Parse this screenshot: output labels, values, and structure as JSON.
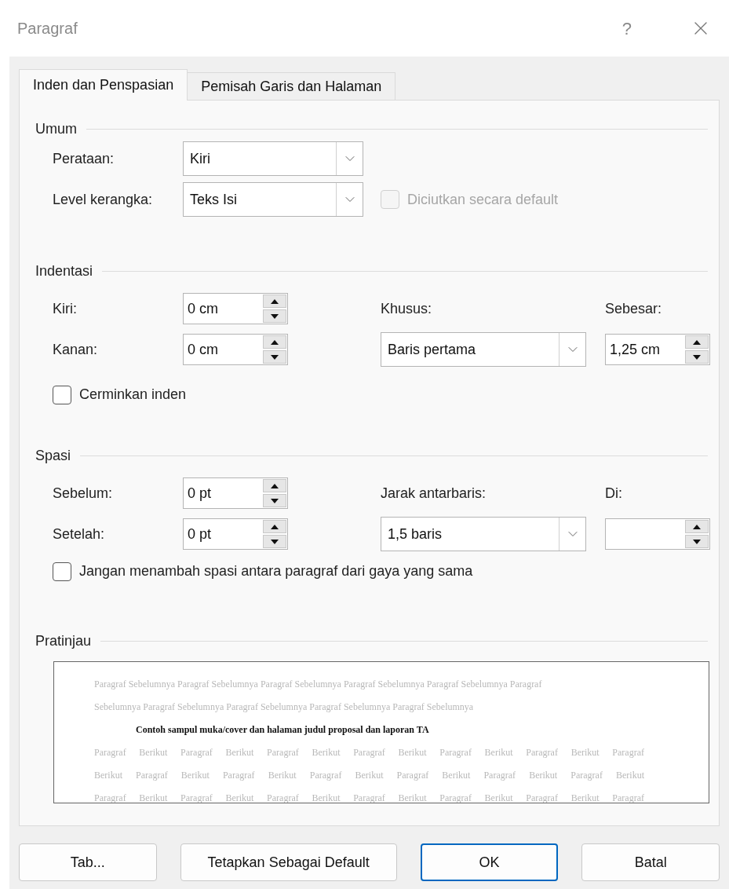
{
  "window": {
    "title": "Paragraf",
    "help": "?"
  },
  "tabs": [
    {
      "label": "Inden dan Penspasian",
      "selected": true
    },
    {
      "label": "Pemisah Garis dan Halaman",
      "selected": false
    }
  ],
  "general": {
    "title": "Umum",
    "alignment": {
      "label": "Perataan:",
      "value": "Kiri"
    },
    "outline_level": {
      "label": "Level kerangka:",
      "value": "Teks Isi"
    },
    "collapsed": {
      "label": "Diciutkan secara default",
      "checked": false,
      "disabled": true
    }
  },
  "indentation": {
    "title": "Indentasi",
    "left": {
      "label": "Kiri:",
      "value": "0 cm"
    },
    "right": {
      "label": "Kanan:",
      "value": "0 cm"
    },
    "special": {
      "label": "Khusus:",
      "value": "Baris pertama"
    },
    "by": {
      "label": "Sebesar:",
      "value": "1,25 cm"
    },
    "mirror": {
      "label": "Cerminkan inden",
      "checked": false,
      "disabled": false
    }
  },
  "spacing": {
    "title": "Spasi",
    "before": {
      "label": "Sebelum:",
      "value": "0 pt"
    },
    "after": {
      "label": "Setelah:",
      "value": "0 pt"
    },
    "line_spacing": {
      "label": "Jarak antarbaris:",
      "value": "1,5 baris"
    },
    "at": {
      "label": "Di:"
    },
    "dont_add": {
      "label": "Jangan menambah spasi antara paragraf dari gaya yang sama",
      "checked": false,
      "disabled": false
    }
  },
  "preview": {
    "title": "Pratinjau",
    "lines": [
      {
        "kind": "previous",
        "text": "Paragraf Sebelumnya Paragraf Sebelumnya Paragraf Sebelumnya Paragraf Sebelumnya Paragraf Sebelumnya Paragraf"
      },
      {
        "kind": "previous",
        "text": "Sebelumnya Paragraf Sebelumnya Paragraf Sebelumnya Paragraf Sebelumnya Paragraf Sebelumnya"
      },
      {
        "kind": "current",
        "text": "Contoh sampul muka/cover dan halaman judul proposal dan laporan  TA"
      },
      {
        "kind": "next",
        "text": "Paragraf Berikut Paragraf Berikut Paragraf Berikut Paragraf Berikut Paragraf Berikut Paragraf Berikut Paragraf"
      },
      {
        "kind": "next",
        "text": "Berikut Paragraf Berikut Paragraf Berikut Paragraf Berikut Paragraf Berikut Paragraf Berikut Paragraf Berikut"
      },
      {
        "kind": "next",
        "text": "Paragraf Berikut Paragraf Berikut Paragraf Berikut Paragraf Berikut Paragraf Berikut Paragraf Berikut Paragraf"
      }
    ]
  },
  "buttons": [
    {
      "label": "Tab...",
      "default": false
    },
    {
      "label": "Tetapkan Sebagai Default",
      "default": false
    },
    {
      "label": "OK",
      "default": true
    },
    {
      "label": "Batal",
      "default": false
    }
  ]
}
